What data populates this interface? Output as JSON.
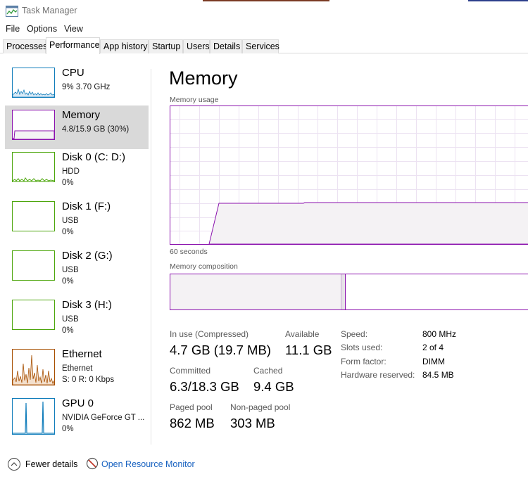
{
  "window": {
    "title": "Task Manager",
    "app_icon": "task-manager-icon"
  },
  "menu": {
    "file": "File",
    "options": "Options",
    "view": "View"
  },
  "tabs": [
    {
      "label": "Processes"
    },
    {
      "label": "Performance",
      "active": true
    },
    {
      "label": "App history"
    },
    {
      "label": "Startup"
    },
    {
      "label": "Users"
    },
    {
      "label": "Details"
    },
    {
      "label": "Services"
    }
  ],
  "sidebar": {
    "items": [
      {
        "name": "CPU",
        "line1": "9%  3.70 GHz",
        "line2": "",
        "color": "#117dbb"
      },
      {
        "name": "Memory",
        "line1": "4.8/15.9 GB (30%)",
        "line2": "",
        "color": "#8b12ae",
        "selected": true
      },
      {
        "name": "Disk 0 (C: D:)",
        "line1": "HDD",
        "line2": "0%",
        "color": "#4da60c"
      },
      {
        "name": "Disk 1 (F:)",
        "line1": "USB",
        "line2": "0%",
        "color": "#4da60c"
      },
      {
        "name": "Disk 2 (G:)",
        "line1": "USB",
        "line2": "0%",
        "color": "#4da60c"
      },
      {
        "name": "Disk 3 (H:)",
        "line1": "USB",
        "line2": "0%",
        "color": "#4da60c"
      },
      {
        "name": "Ethernet",
        "line1": "Ethernet",
        "line2": "S: 0  R: 0 Kbps",
        "color": "#a74f01"
      },
      {
        "name": "GPU 0",
        "line1": "NVIDIA GeForce GT ...",
        "line2": "0%",
        "color": "#117dbb"
      }
    ]
  },
  "main": {
    "title": "Memory",
    "usage_label": "Memory usage",
    "time_label": "60 seconds",
    "composition_label": "Memory composition",
    "in_use_label": "In use (Compressed)",
    "in_use_value": "4.7 GB (19.7 MB)",
    "available_label": "Available",
    "available_value": "11.1 GB",
    "committed_label": "Committed",
    "committed_value": "6.3/18.3 GB",
    "cached_label": "Cached",
    "cached_value": "9.4 GB",
    "paged_label": "Paged pool",
    "paged_value": "862 MB",
    "nonpaged_label": "Non-paged pool",
    "nonpaged_value": "303 MB",
    "speed_label": "Speed:",
    "speed_value": "800 MHz",
    "slots_label": "Slots used:",
    "slots_value": "2 of 4",
    "form_label": "Form factor:",
    "form_value": "DIMM",
    "hw_label": "Hardware reserved:",
    "hw_value": "84.5 MB"
  },
  "footer": {
    "fewer_details": "Fewer details",
    "fewer_icon": "chevron-up-circle-icon",
    "open_resource_monitor": "Open Resource Monitor",
    "orm_icon": "resource-monitor-icon"
  },
  "colors": {
    "memory": "#8b12ae",
    "memory_fill": "#f4f2f4",
    "grid": "#e8daf0",
    "link": "#1862c0",
    "selected_bg": "#d9d9d9"
  }
}
